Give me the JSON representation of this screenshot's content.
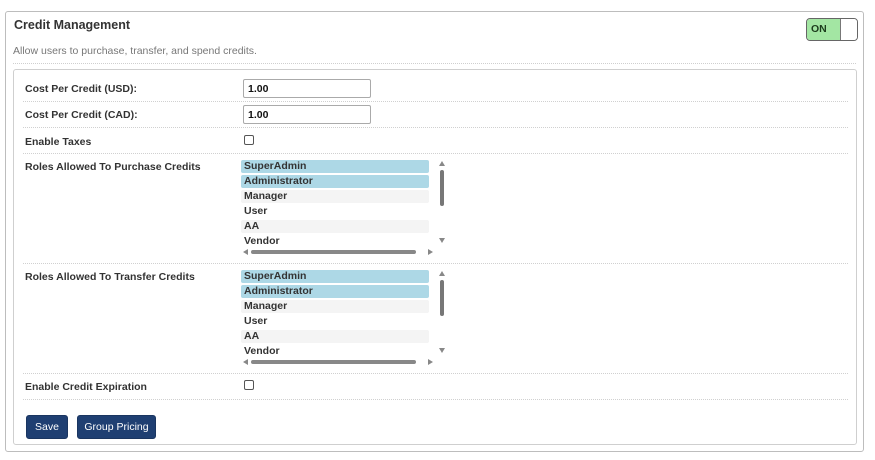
{
  "panel": {
    "title": "Credit Management",
    "description": "Allow users to purchase, transfer, and spend credits.",
    "toggle": {
      "label": "ON",
      "state": true,
      "color": "#a3e6a3"
    }
  },
  "fields": {
    "cost_usd": {
      "label": "Cost Per Credit (USD):",
      "value": "1.00"
    },
    "cost_cad": {
      "label": "Cost Per Credit (CAD):",
      "value": "1.00"
    },
    "enable_taxes": {
      "label": "Enable Taxes",
      "checked": false
    },
    "purchase_roles": {
      "label": "Roles Allowed To Purchase Credits",
      "options": [
        "SuperAdmin",
        "Administrator",
        "Manager",
        "User",
        "AA",
        "Vendor"
      ],
      "selected": [
        "SuperAdmin",
        "Administrator"
      ]
    },
    "transfer_roles": {
      "label": "Roles Allowed To Transfer Credits",
      "options": [
        "SuperAdmin",
        "Administrator",
        "Manager",
        "User",
        "AA",
        "Vendor"
      ],
      "selected": [
        "SuperAdmin",
        "Administrator"
      ]
    },
    "enable_expiration": {
      "label": "Enable Credit Expiration",
      "checked": false
    }
  },
  "buttons": {
    "save": "Save",
    "group_pricing": "Group Pricing"
  },
  "colors": {
    "primary_button": "#1f3f72",
    "selected_option": "#add8e6"
  }
}
